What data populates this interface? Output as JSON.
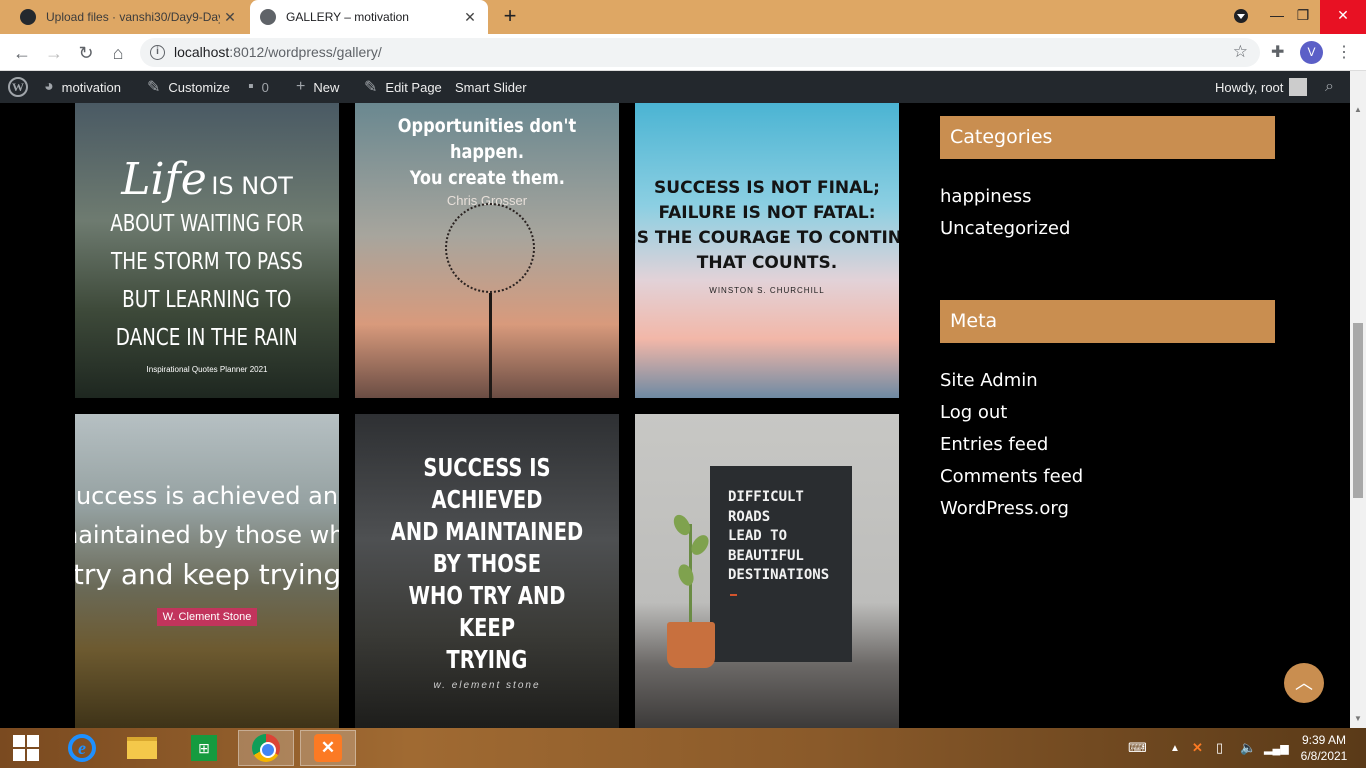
{
  "browser": {
    "tabs": [
      {
        "title": "Upload files · vanshi30/Day9-Day",
        "active": false
      },
      {
        "title": "GALLERY – motivation",
        "active": true
      }
    ],
    "url_host": "localhost",
    "url_rest": ":8012/wordpress/gallery/",
    "profile_initial": "V",
    "new_tab_label": "+",
    "close_label": "✕"
  },
  "adminbar": {
    "site_name": "motivation",
    "customize": "Customize",
    "comments_count": "0",
    "new_label": "New",
    "edit_page": "Edit Page",
    "smart_slider": "Smart Slider",
    "howdy": "Howdy, root"
  },
  "gallery": {
    "t1": {
      "life": "Life",
      "lines": [
        "IS NOT",
        "ABOUT WAITING FOR",
        "THE STORM TO PASS",
        "BUT LEARNING TO",
        "DANCE IN THE RAIN"
      ],
      "small": "Inspirational Quotes Planner 2021"
    },
    "t2": {
      "quote": [
        "Opportunities don't happen.",
        "You create them."
      ],
      "author": "Chris Grosser"
    },
    "t3": {
      "quote": [
        "SUCCESS IS NOT FINAL;",
        "FAILURE IS NOT FATAL:",
        "IT IS THE COURAGE TO CONTINUE",
        "THAT COUNTS."
      ],
      "author": "WINSTON S. CHURCHILL"
    },
    "t4": {
      "quote": [
        "Success is achieved and",
        "maintained by those who",
        "try and keep trying"
      ],
      "author": "W. Clement Stone"
    },
    "t5": {
      "quote": [
        "SUCCESS IS ACHIEVED",
        "AND MAINTAINED BY THOSE",
        "WHO TRY AND KEEP",
        "TRYING"
      ],
      "author": "w. element stone"
    },
    "t6": {
      "quote": [
        "DIFFICULT",
        "ROADS",
        "LEAD TO",
        "BEAUTIFUL",
        "DESTINATIONS"
      ]
    }
  },
  "sidebar": {
    "categories_title": "Categories",
    "categories": [
      "happiness",
      "Uncategorized"
    ],
    "meta_title": "Meta",
    "meta_links": [
      "Site Admin",
      "Log out",
      "Entries feed",
      "Comments feed",
      "WordPress.org"
    ]
  },
  "taskbar": {
    "time": "9:39 AM",
    "date": "6/8/2021"
  }
}
